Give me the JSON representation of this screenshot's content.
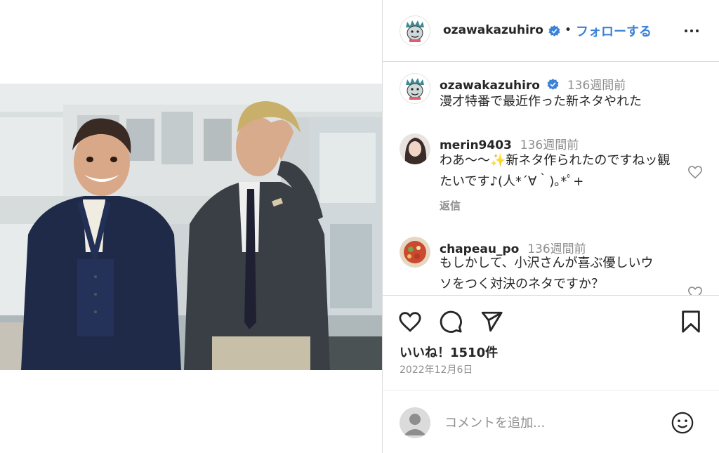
{
  "post": {
    "author": "ozawakazuhiro",
    "follow_label": "フォローする",
    "separator": "•"
  },
  "comments": [
    {
      "user": "ozawakazuhiro",
      "time": "136週間前",
      "lines": [
        "漫才特番で最近作った新ネタやれた"
      ]
    },
    {
      "user": "merin9403",
      "time": "136週間前",
      "lines": [
        "わあ〜〜✨新ネタ作られたのですねッ観",
        "たいです♪(人*´∀｀)｡*ﾟ+"
      ],
      "reply_label": "返信"
    },
    {
      "user": "chapeau_po",
      "time": "136週間前",
      "lines": [
        "もしかして、小沢さんが喜ぶ優しいウ",
        "ソをつく対決のネタですか？"
      ]
    }
  ],
  "stats": {
    "likes": "いいね！1510件",
    "date": "2022年12月6日"
  },
  "add_comment": {
    "placeholder": "コメントを追加..."
  },
  "icons": {
    "verified": "verified-badge-icon",
    "more": "more-options-icon",
    "like": "heart-icon",
    "comment": "comment-icon",
    "share": "share-icon",
    "save": "bookmark-icon",
    "emoji": "emoji-icon"
  },
  "colors": {
    "accent": "#3b82d6",
    "muted": "#8e8e8e",
    "border": "#dbdbdb"
  }
}
